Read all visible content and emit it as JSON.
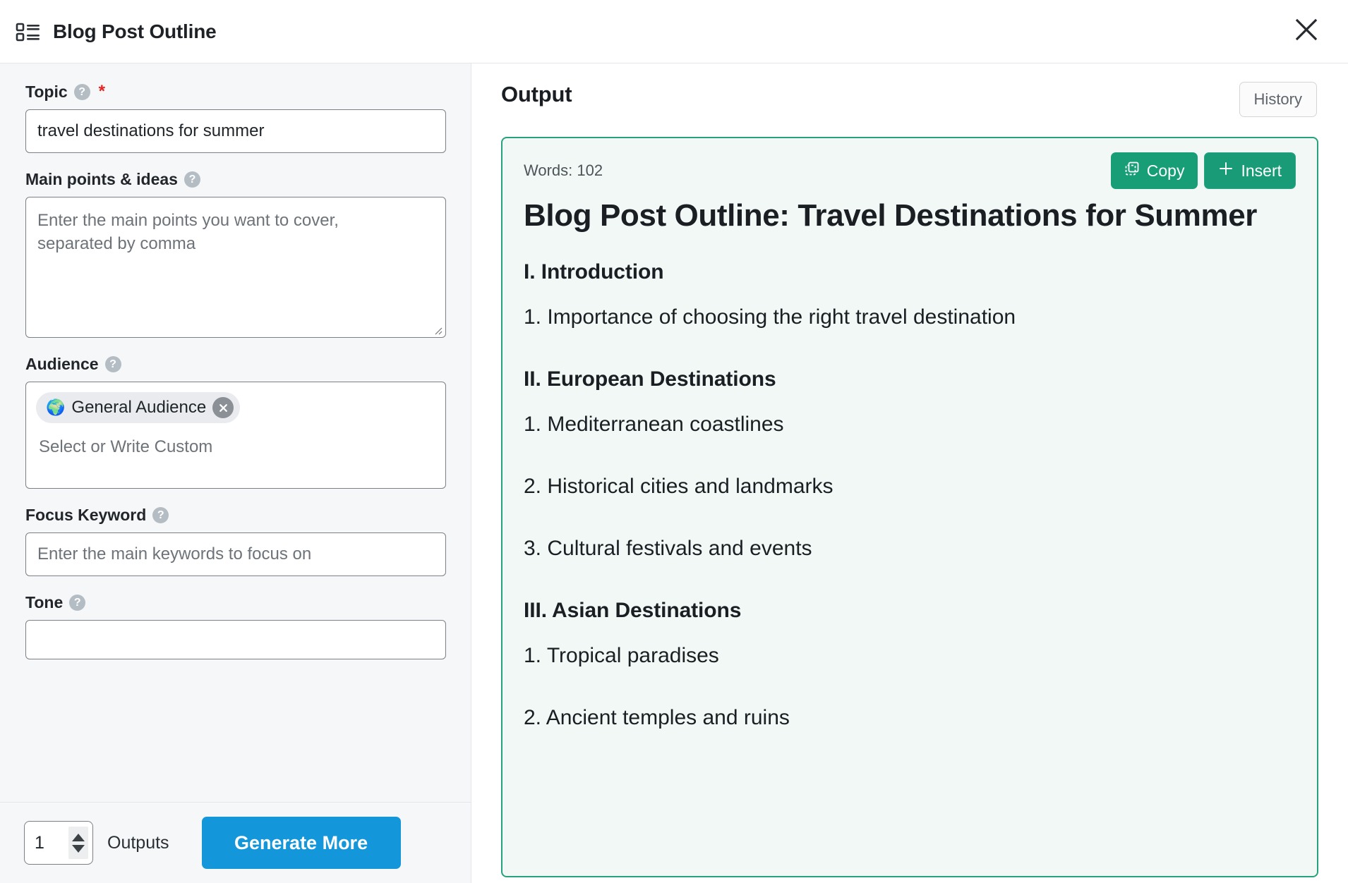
{
  "header": {
    "title": "Blog Post Outline",
    "list_icon": "list-bullet-icon",
    "close_icon": "close-icon"
  },
  "form": {
    "fields": [
      {
        "label": "Topic",
        "help_icon": "help-circle-icon",
        "required_marker": "*",
        "type": "text",
        "value": "travel destinations for summer",
        "placeholder": ""
      },
      {
        "label": "Main points & ideas",
        "help_icon": "help-circle-icon",
        "type": "textarea",
        "value": "",
        "placeholder": "Enter the main points you want to cover, separated by comma"
      },
      {
        "label": "Audience",
        "help_icon": "help-circle-icon",
        "type": "tags",
        "tags": [
          {
            "emoji": "🌍",
            "label": "General Audience",
            "remove_icon": "close-circle-icon"
          }
        ],
        "placeholder": "Select or Write Custom"
      },
      {
        "label": "Focus Keyword",
        "help_icon": "help-circle-icon",
        "type": "text",
        "value": "",
        "placeholder": "Enter the main keywords to focus on"
      },
      {
        "label": "Tone",
        "help_icon": "help-circle-icon",
        "type": "select",
        "value": ""
      }
    ],
    "footer": {
      "outputs_count": "1",
      "outputs_label": "Outputs",
      "generate_label": "Generate More",
      "generate_color": "#1497da",
      "stepper_up_icon": "chevron-up-icon",
      "stepper_down_icon": "chevron-down-icon"
    }
  },
  "output": {
    "title": "Output",
    "history_label": "History",
    "card": {
      "words_label": "Words: 102",
      "copy_label": "Copy",
      "copy_icon": "copy-icon",
      "insert_label": "Insert",
      "insert_icon": "plus-icon",
      "accent_color": "#27a17e",
      "background_color": "#f1f8f5",
      "heading": "Blog Post Outline: Travel Destinations for Summer",
      "blocks": [
        {
          "level": "h2",
          "text": "I. Introduction"
        },
        {
          "level": "p",
          "text": "1. Importance of choosing the right travel destination"
        },
        {
          "level": "h2",
          "text": "II. European Destinations"
        },
        {
          "level": "p",
          "text": "1. Mediterranean coastlines"
        },
        {
          "level": "p",
          "text": "2. Historical cities and landmarks"
        },
        {
          "level": "p",
          "text": "3. Cultural festivals and events"
        },
        {
          "level": "h2",
          "text": "III. Asian Destinations"
        },
        {
          "level": "p",
          "text": "1. Tropical paradises"
        },
        {
          "level": "p",
          "text": "2. Ancient temples and ruins"
        }
      ]
    },
    "annotation": {
      "type": "arrow",
      "color": "#7d42b5",
      "points_to": "Insert"
    }
  }
}
